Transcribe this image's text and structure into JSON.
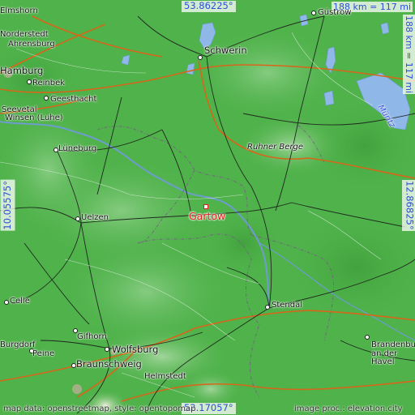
{
  "map": {
    "target": "Gartow",
    "coords": {
      "top": "53.86225°",
      "bottom": "52.17057°",
      "left": "10.05575°",
      "right": "12.86825°"
    },
    "scale": {
      "horizontal": "188 km = 117 mi",
      "vertical": "188 km = 117 mi"
    },
    "cities": [
      {
        "name": "Schwerin"
      },
      {
        "name": "Güstrow"
      },
      {
        "name": "Lüneburg"
      },
      {
        "name": "Uelzen"
      },
      {
        "name": "Stendal"
      },
      {
        "name": "Wolfsburg"
      },
      {
        "name": "Braunschweig"
      },
      {
        "name": "Celle"
      },
      {
        "name": "Geesthacht"
      },
      {
        "name": "Reinbek"
      },
      {
        "name": "Seevetal"
      },
      {
        "name": "Winsen (Luhe)"
      },
      {
        "name": "Ahrensburg"
      },
      {
        "name": "Gifhorn"
      },
      {
        "name": "Peine"
      },
      {
        "name": "Helmstedt"
      },
      {
        "name": "Brandenburg an der Havel"
      },
      {
        "name": "Burgdorf"
      },
      {
        "name": "Norderstedt"
      },
      {
        "name": "Elmshorn"
      },
      {
        "name": "Hamburg"
      }
    ],
    "features": {
      "ruhner_berge": "Ruhner Berge",
      "mueritz": "Müritz"
    },
    "credits": {
      "left": "map data: openstreetmap, style: opentopomap",
      "right": "image proc.: elevation.city"
    },
    "colors": {
      "lowland": "#4fb24a",
      "hill": "#7dc27a",
      "water": "#8fb8e8",
      "motorway": "#d8661a",
      "road": "#1a1a1a",
      "boundary": "#7a5a8a",
      "marker": "#e02020",
      "coord_text": "#2b4fd9"
    }
  }
}
